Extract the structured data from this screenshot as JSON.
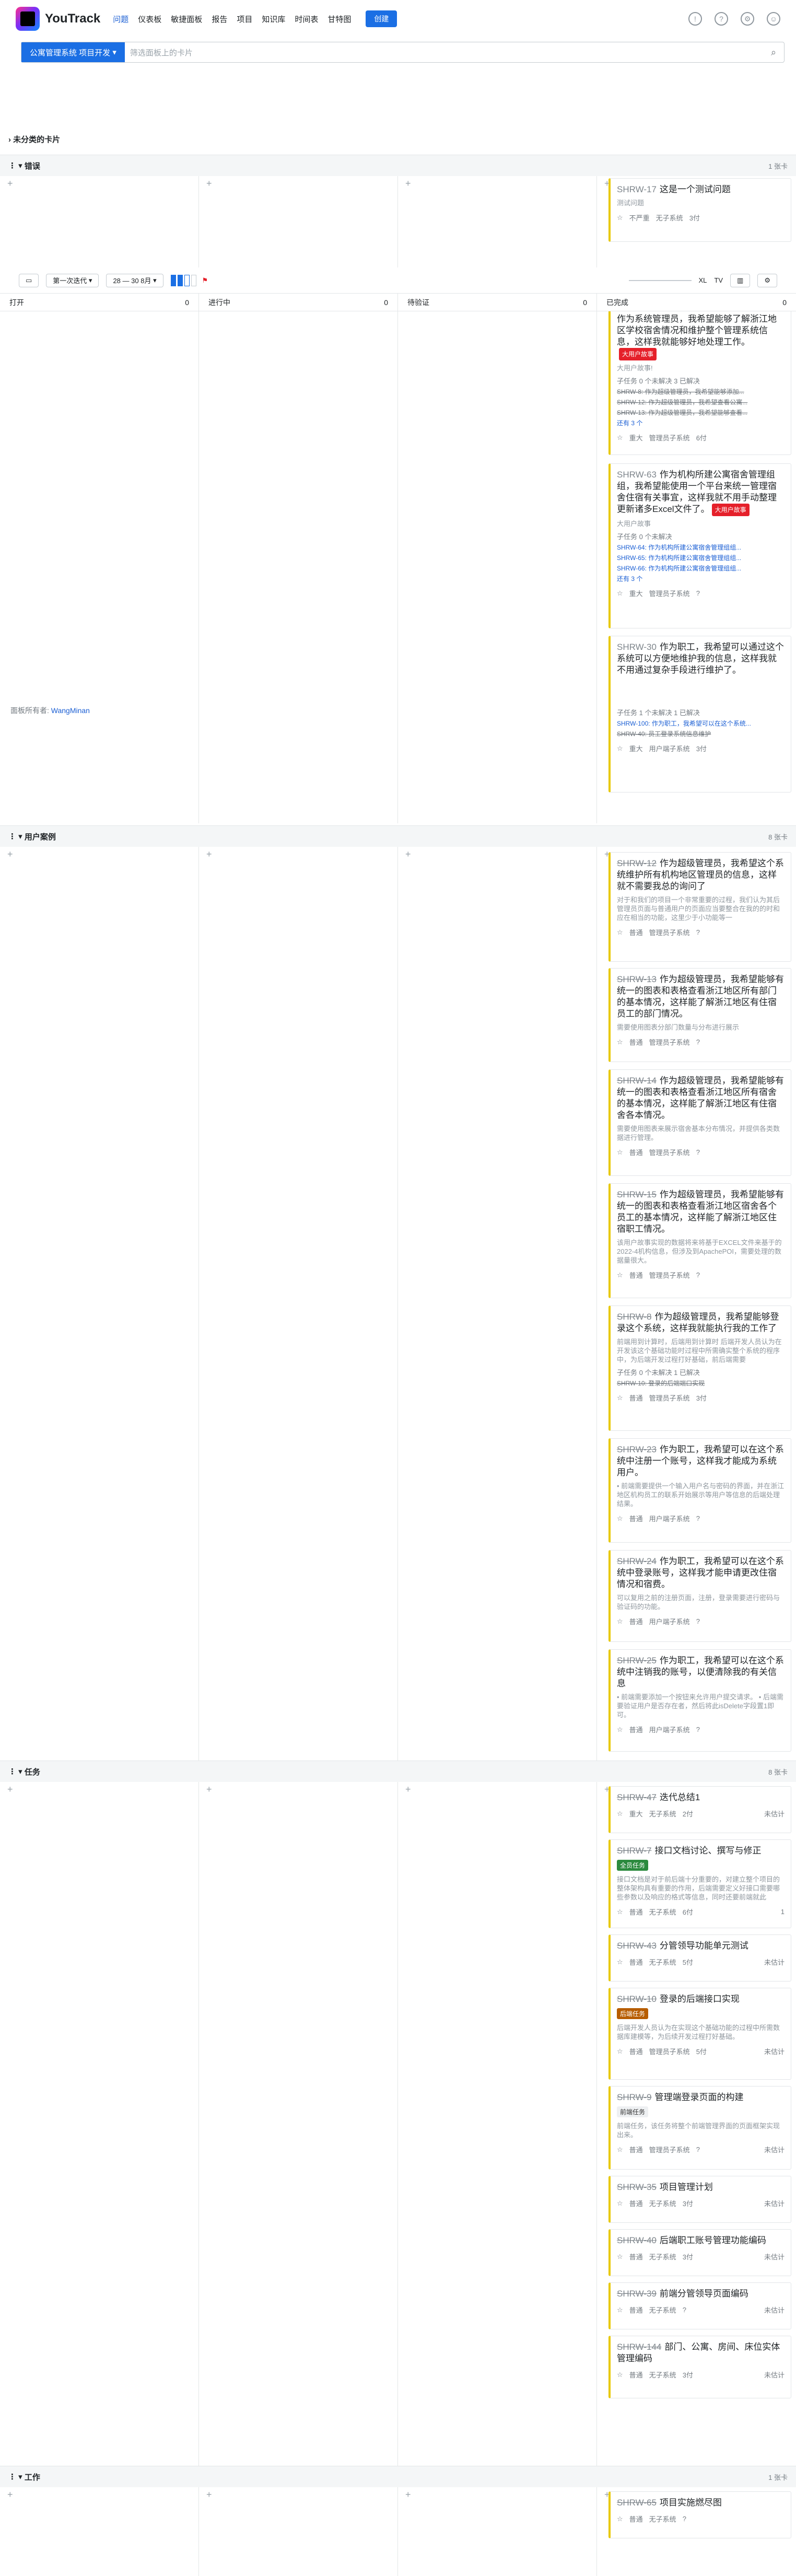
{
  "topnav": {
    "brand": "YouTrack",
    "links": [
      "问题",
      "仪表板",
      "敏捷面板",
      "报告",
      "项目",
      "知识库",
      "时间表",
      "甘特图"
    ],
    "create_label": "创建"
  },
  "search": {
    "project": "公寓管理系统 项目开发",
    "placeholder": "筛选面板上的卡片"
  },
  "uncategorized_label": "未分类的卡片",
  "toolbar": {
    "sprint": "第一次迭代",
    "date_range": "28 — 30 8月",
    "size_xl": "XL",
    "size_tv": "TV",
    "stat_icon": "chart-icon",
    "settings_icon": "gear-icon"
  },
  "columns": [
    {
      "name": "打开",
      "count": "0"
    },
    {
      "name": "进行中",
      "count": "0"
    },
    {
      "name": "待验证",
      "count": "0"
    },
    {
      "name": "已完成",
      "count": "0"
    }
  ],
  "board_owner": {
    "label": "面板所有者:",
    "name": "WangMinan"
  },
  "lanes": [
    {
      "name": "错误",
      "count": "1 张卡",
      "cards": [
        {
          "id": "SHRW-17",
          "title": "这是一个测试问题",
          "desc": "测试问题",
          "foot": [
            "☆",
            "不严重",
            "无子系统",
            "3付"
          ]
        },
        {
          "id": "SHRW-",
          "title": "作为系统管理员，我希望能够了解浙江地区学校宿舍情况和维护整个管理系统信息，这样我就能够好地处理工作。",
          "tag": "大用户故事",
          "desc": "大用户故事!",
          "subtasks": "子任务 0 个未解决 3 已解决",
          "sub": [
            "SHRW-8: 作为超级管理员，我希望能够添加...",
            "SHRW-12: 作为超级管理员，我希望查看公寓...",
            "SHRW-13: 作为超级管理员，我希望能够查看..."
          ],
          "more": "还有 3 个",
          "foot": [
            "☆",
            "重大",
            "管理员子系统",
            "6付"
          ]
        },
        {
          "id": "SHRW-63",
          "title": "作为机构所建公寓宿舍管理组组，我希望能使用一个平台来统一管理宿舍住宿有关事宜，这样我就不用手动整理更新诸多Excel文件了。",
          "tag": "大用户故事",
          "desc": "大用户故事",
          "subtasks": "子任务 0 个未解决",
          "sublinks": [
            "SHRW-64: 作为机构所建公寓宿舍管理组组...",
            "SHRW-65: 作为机构所建公寓宿舍管理组组...",
            "SHRW-66: 作为机构所建公寓宿舍管理组组..."
          ],
          "more": "还有 3 个",
          "foot": [
            "☆",
            "重大",
            "管理员子系统",
            "?"
          ]
        },
        {
          "id": "SHRW-30",
          "title": "作为职工，我希望可以通过这个系统可以方便地维护我的信息，这样我就不用通过复杂手段进行维护了。",
          "subtasks": "子任务 1 个未解决 1 已解决",
          "sublinks": [
            "SHRW-100: 作为职工，我希望可以在这个系统..."
          ],
          "sub": [
            "SHRW-40: 员工登录系统信息维护"
          ],
          "foot": [
            "☆",
            "重大",
            "用户端子系统",
            "3付"
          ]
        }
      ]
    },
    {
      "name": "用户案例",
      "count": "8 张卡",
      "cards": [
        {
          "id": "SHRW-12",
          "title": "作为超级管理员，我希望这个系统维护所有机构地区管理员的信息，这样就不需要我总的询问了",
          "desc": "对于和我们的项目一个非常重要的过程，我们认为其后管理员页面与普通用户的页面应当要整合在我的的时和应在相当的功能，这里少于小功能等一",
          "foot": [
            "☆",
            "普通",
            "管理员子系统",
            "?"
          ]
        },
        {
          "id": "SHRW-13",
          "title": "作为超级管理员，我希望能够有统一的图表和表格查看浙江地区所有部门的基本情况，这样能了解浙江地区有住宿员工的部门情况。",
          "desc": "需要使用图表分部门数量与分布进行展示",
          "foot": [
            "☆",
            "普通",
            "管理员子系统",
            "?"
          ]
        },
        {
          "id": "SHRW-14",
          "title": "作为超级管理员，我希望能够有统一的图表和表格查看浙江地区所有宿舍的基本情况，这样能了解浙江地区有住宿舍各本情况。",
          "desc": "需要使用图表来展示宿舍基本分布情况，并提供各类数据进行管理。",
          "foot": [
            "☆",
            "普通",
            "管理员子系统",
            "?"
          ]
        },
        {
          "id": "SHRW-15",
          "title": "作为超级管理员，我希望能够有统一的图表和表格查看浙江地区宿舍各个员工的基本情况，这样能了解浙江地区住宿职工情况。",
          "desc": "该用户故事实现的数据将来将基于EXCEL文件来基于的2022-4机构信息，但涉及到ApachePOI，需要处理的数据量很大。",
          "foot": [
            "☆",
            "普通",
            "管理员子系统",
            "?"
          ]
        },
        {
          "id": "SHRW-8",
          "title": "作为超级管理员，我希望能够登录这个系统，这样我就能执行我的工作了",
          "desc": "前端用到计算时，后端用到计算时 后端开发人员认为在开发该这个基础功能时过程中所需确实整个系统的程序中，为后端开发过程打好基础，前后端需要",
          "subtasks": "子任务 0 个未解决 1 已解决",
          "sub": [
            "SHRW-10: 登录的后端端口实现"
          ],
          "foot": [
            "☆",
            "普通",
            "管理员子系统",
            "3付"
          ]
        },
        {
          "id": "SHRW-23",
          "title": "作为职工，我希望可以在这个系统中注册一个账号，这样我才能成为系统用户。",
          "desc": "• 前端需要提供一个输入用户名与密码的界面，并在浙江地区机构员工的联系开始展示等用户等信息的后端处理结果。",
          "foot": [
            "☆",
            "普通",
            "用户端子系统",
            "?"
          ]
        },
        {
          "id": "SHRW-24",
          "title": "作为职工，我希望可以在这个系统中登录账号，这样我才能申请更改住宿情况和宿费。",
          "desc": "可以复用之前的注册页面，注册，登录需要进行密码与验证码的功能。",
          "foot": [
            "☆",
            "普通",
            "用户端子系统",
            "?"
          ]
        },
        {
          "id": "SHRW-25",
          "title": "作为职工，我希望可以在这个系统中注销我的账号，以便清除我的有关信息",
          "desc": "• 前端需要添加一个按钮来允许用户提交请求。 • 后端需要验证用户是否存在者，然后将此isDelete字段置1即可。",
          "foot": [
            "☆",
            "普通",
            "用户端子系统",
            "?"
          ]
        }
      ]
    },
    {
      "name": "任务",
      "count": "8 张卡",
      "cards": [
        {
          "id": "SHRW-47",
          "title": "迭代总结1",
          "foot": [
            "☆",
            "重大",
            "无子系统",
            "2付"
          ],
          "est": "未估计"
        },
        {
          "id": "SHRW-7",
          "title": "接口文档讨论、撰写与修正",
          "tag": "全员任务",
          "tagc": "green",
          "desc": "接口文档是对于前后端十分重要的，对建立整个项目的整体架构具有重要的作用，后端需要定义好接口需要哪些参数以及响应的格式等信息，同时还要前端就此",
          "foot": [
            "☆",
            "普通",
            "无子系统",
            "6付"
          ],
          "est": "1"
        },
        {
          "id": "SHRW-43",
          "title": "分管领导功能单元测试",
          "foot": [
            "☆",
            "普通",
            "无子系统",
            "5付"
          ],
          "est": "未估计"
        },
        {
          "id": "SHRW-10",
          "title": "登录的后端接口实现",
          "tag": "后端任务",
          "tagc": "amber",
          "desc": "后端开发人员认为在实现这个基础功能的过程中所需数据库建模等，为后续开发过程打好基础。",
          "foot": [
            "☆",
            "普通",
            "管理员子系统",
            "5付"
          ],
          "est": "未估计"
        },
        {
          "id": "SHRW-9",
          "title": "管理端登录页面的构建",
          "tag": "前端任务",
          "tagc": "grey",
          "desc": "前端任务，该任务将整个前端管理界面的页面框架实现出来。",
          "foot": [
            "☆",
            "普通",
            "管理员子系统",
            "?"
          ],
          "est": "未估计"
        },
        {
          "id": "SHRW-35",
          "title": "项目管理计划",
          "foot": [
            "☆",
            "普通",
            "无子系统",
            "3付"
          ],
          "est": "未估计"
        },
        {
          "id": "SHRW-40",
          "title": "后端职工账号管理功能编码",
          "foot": [
            "☆",
            "普通",
            "无子系统",
            "3付"
          ],
          "est": "未估计"
        },
        {
          "id": "SHRW-39",
          "title": "前端分管领导页面编码",
          "foot": [
            "☆",
            "普通",
            "无子系统",
            "?"
          ],
          "est": "未估计"
        },
        {
          "id": "SHRW-144",
          "title": "部门、公寓、房间、床位实体管理编码",
          "foot": [
            "☆",
            "普通",
            "无子系统",
            "3付"
          ],
          "est": "未估计"
        }
      ]
    },
    {
      "name": "工作",
      "count": "1 张卡",
      "cards": [
        {
          "id": "SHRW-65",
          "title": "项目实施燃尽图",
          "foot": [
            "☆",
            "普通",
            "无子系统",
            "?"
          ]
        }
      ]
    }
  ]
}
